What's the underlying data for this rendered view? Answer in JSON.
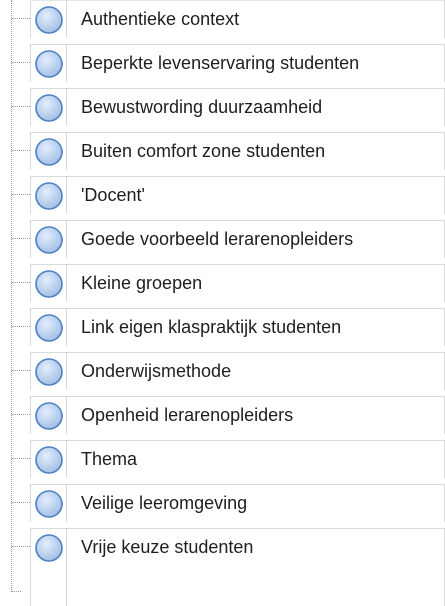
{
  "tree": {
    "node_icon": "circle-node-icon",
    "node_colors": {
      "fill_light": "#e3eefc",
      "fill_dark": "#9dbde6",
      "stroke": "#4f7fbf"
    },
    "items": [
      {
        "label": "Authentieke context"
      },
      {
        "label": "Beperkte levenservaring studenten"
      },
      {
        "label": "Bewustwording duurzaamheid"
      },
      {
        "label": "Buiten comfort zone studenten"
      },
      {
        "label": "'Docent'"
      },
      {
        "label": "Goede voorbeeld lerarenopleiders"
      },
      {
        "label": "Kleine groepen"
      },
      {
        "label": "Link eigen klaspraktijk studenten"
      },
      {
        "label": "Onderwijsmethode"
      },
      {
        "label": "Openheid lerarenopleiders"
      },
      {
        "label": "Thema"
      },
      {
        "label": "Veilige leeromgeving"
      },
      {
        "label": "Vrije keuze studenten"
      }
    ]
  }
}
